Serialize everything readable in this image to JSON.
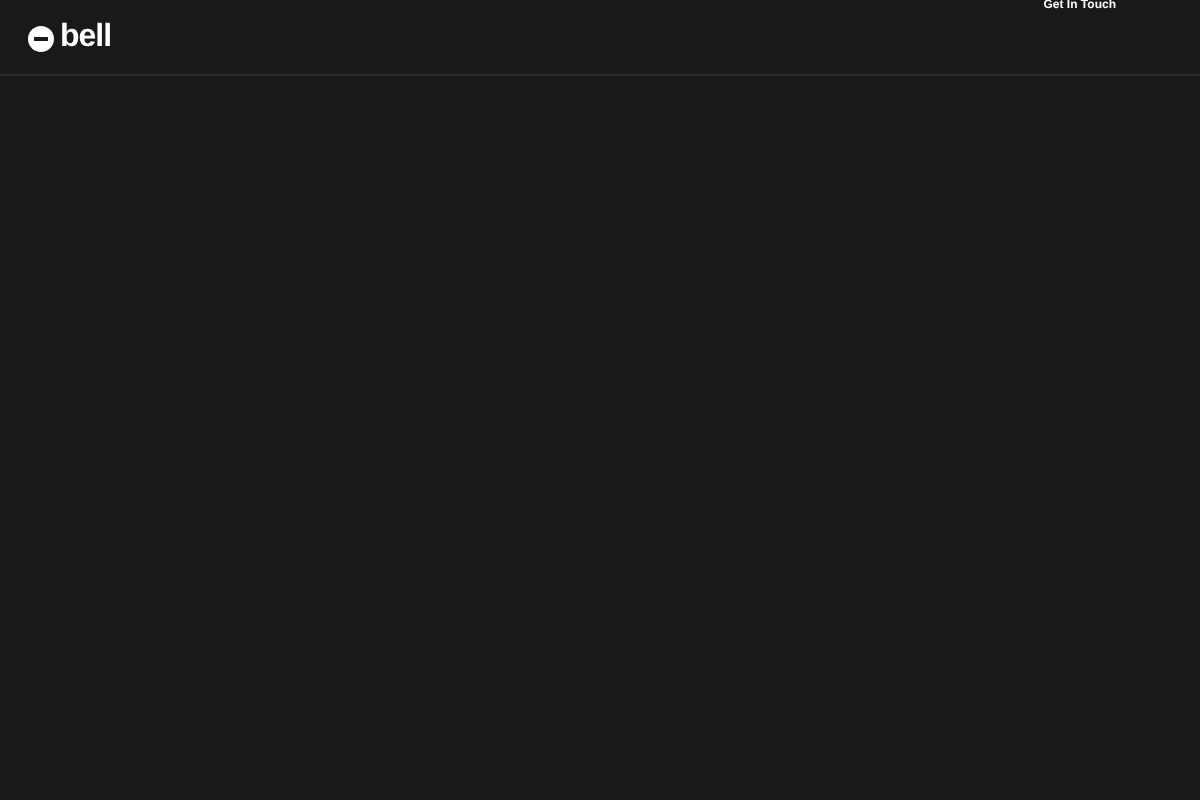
{
  "header": {
    "logo": "bell",
    "link": "Get In Touch"
  }
}
